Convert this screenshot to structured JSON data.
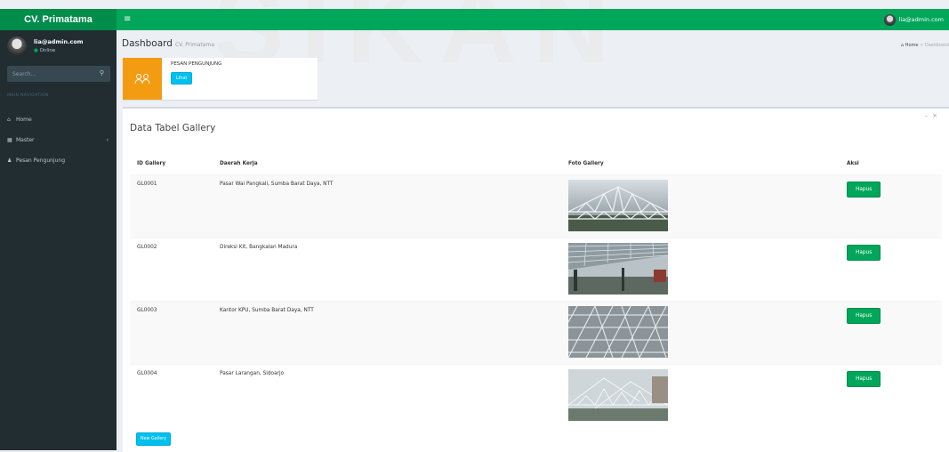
{
  "app": {
    "logo": "CV. Primatama",
    "user_email": "lia@admin.com",
    "toggle_icon": "≡"
  },
  "sidebar": {
    "user": {
      "name": "lia@admin.com",
      "status": "Online"
    },
    "search": {
      "placeholder": "Search..."
    },
    "nav_header": "MAIN NAVIGATION",
    "items": [
      {
        "label": "Home",
        "icon": "home-icon"
      },
      {
        "label": "Master",
        "icon": "table-icon"
      },
      {
        "label": "Pesan Pengunjung",
        "icon": "user-icon"
      }
    ]
  },
  "header": {
    "title": "Dashboard",
    "subtitle": "CV. Primatama",
    "breadcrumb": {
      "home": "Home",
      "current": "Dashboard"
    }
  },
  "infobox": {
    "label": "PESAN PENGUNJUNG",
    "button": "Lihat"
  },
  "box": {
    "title": "Data Tabel Gallery",
    "columns": [
      "ID Gallery",
      "Daerah Kerja",
      "Foto Gallery",
      "Aksi"
    ],
    "rows": [
      {
        "id": "GL0001",
        "area": "Pasar Wai Pangkali, Sumba Barat Daya, NTT",
        "action": "Hapus"
      },
      {
        "id": "GL0002",
        "area": "Direksi Kit, Bangkalan Madura",
        "action": "Hapus"
      },
      {
        "id": "GL0003",
        "area": "Kantor KPU, Sumba Barat Daya, NTT",
        "action": "Hapus"
      },
      {
        "id": "GL0004",
        "area": "Pasar Larangan, Sidoarjo",
        "action": "Hapus"
      }
    ],
    "new_button": "New Gallery"
  },
  "colors": {
    "brand": "#00a65a",
    "sidebar": "#222d32",
    "info": "#00c0ef",
    "warning": "#f39c12"
  }
}
